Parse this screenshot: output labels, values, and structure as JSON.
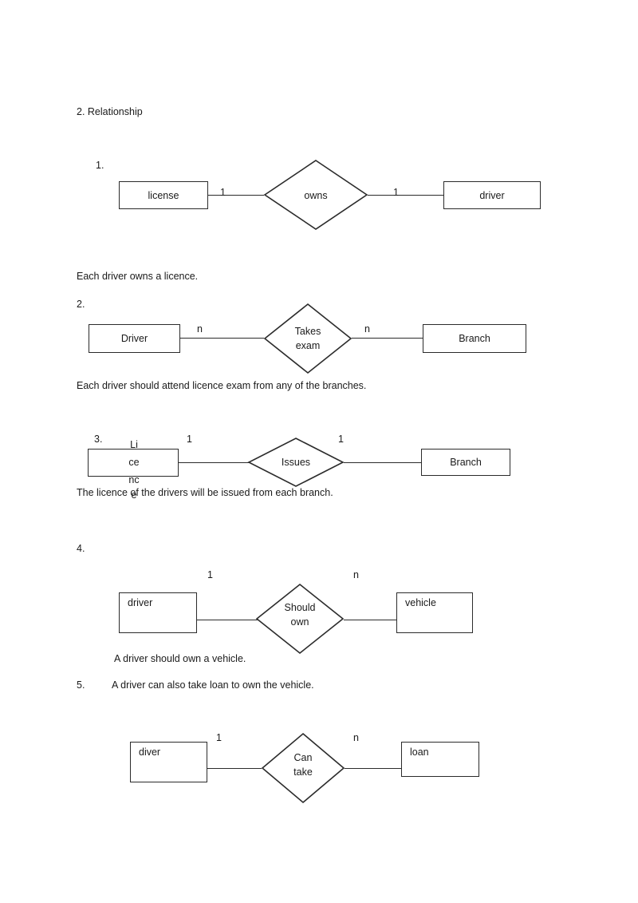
{
  "document": {
    "heading": "2. Relationship"
  },
  "diagrams": [
    {
      "number": "1.",
      "left_entity": "license",
      "left_cardinality": "1",
      "relationship": "owns",
      "relationship_line2": "",
      "right_cardinality": "1",
      "right_entity": "driver",
      "caption": "Each driver owns a licence."
    },
    {
      "number": "2.",
      "left_entity": "Driver",
      "left_cardinality": "n",
      "relationship": "Takes",
      "relationship_line2": "exam",
      "right_cardinality": "n",
      "right_entity": "Branch",
      "caption": "Each driver should attend licence exam from any of the branches."
    },
    {
      "number": "3.",
      "left_entity_fragments": [
        "Li",
        "ce",
        "nc",
        "e"
      ],
      "left_entity": "Licence",
      "left_cardinality": "1",
      "relationship": "Issues",
      "relationship_line2": "",
      "right_cardinality": "1",
      "right_entity": "Branch",
      "caption": "The licence of the drivers will be issued from each branch."
    },
    {
      "number": "4.",
      "left_entity": "driver",
      "left_cardinality": "1",
      "relationship": "Should",
      "relationship_line2": "own",
      "right_cardinality": "n",
      "right_entity": "vehicle",
      "caption": "A driver should own a vehicle."
    },
    {
      "number": "5.",
      "intro": "A driver can also take loan to own the vehicle.",
      "left_entity": "diver",
      "left_cardinality": "1",
      "relationship": "Can",
      "relationship_line2": "take",
      "right_cardinality": "n",
      "right_entity": "loan",
      "caption": ""
    }
  ]
}
